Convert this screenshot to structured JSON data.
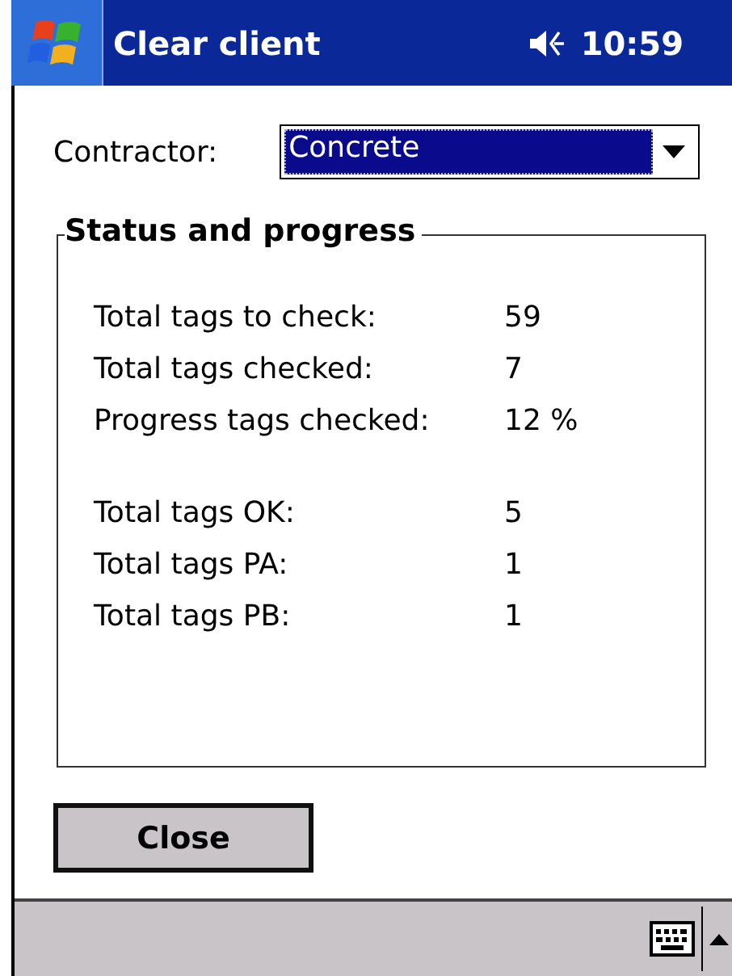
{
  "title_bar": {
    "title": "Clear client",
    "time": "10:59"
  },
  "contractor": {
    "label": "Contractor:",
    "value": "Concrete"
  },
  "status_group": {
    "title": "Status and progress",
    "sections": [
      {
        "rows": [
          {
            "label": "Total tags to check:",
            "value": "59"
          },
          {
            "label": "Total tags checked:",
            "value": "7"
          },
          {
            "label": "Progress tags checked:",
            "value": "12 %"
          }
        ]
      },
      {
        "rows": [
          {
            "label": "Total tags OK:",
            "value": "5"
          },
          {
            "label": "Total tags PA:",
            "value": "1"
          },
          {
            "label": "Total tags PB:",
            "value": "1"
          }
        ]
      }
    ]
  },
  "buttons": [
    "Close"
  ]
}
